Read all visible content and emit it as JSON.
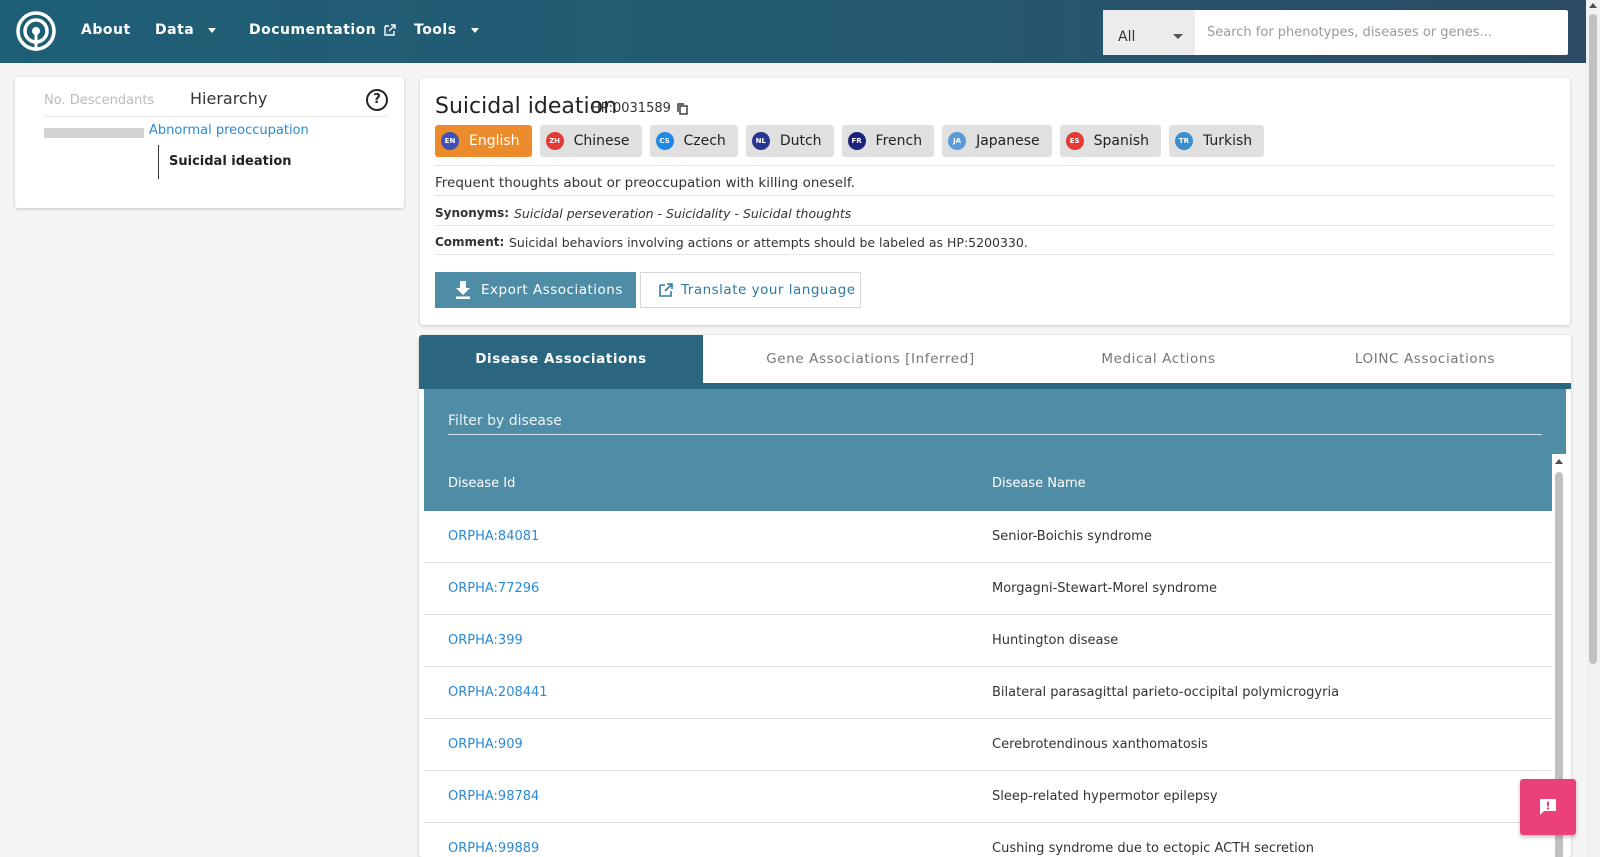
{
  "nav": {
    "about": "About",
    "data": "Data",
    "documentation": "Documentation",
    "tools": "Tools"
  },
  "search": {
    "scope": "All",
    "placeholder": "Search for phenotypes, diseases or genes..."
  },
  "hierarchy": {
    "descendants_label": "No. Descendants",
    "title": "Hierarchy",
    "help": "?",
    "parent": "Abnormal preoccupation",
    "current": "Suicidal ideation"
  },
  "term": {
    "name": "Suicidal ideation",
    "id": "HP:0031589",
    "definition": "Frequent thoughts about or preoccupation with killing oneself.",
    "synonyms_label": "Synonyms:",
    "synonyms": "Suicidal perseveration - Suicidality - Suicidal thoughts",
    "comment_label": "Comment:",
    "comment": "Suicidal behaviors involving actions or attempts should be labeled as HP:5200330.",
    "export_label": "Export Associations",
    "translate_label": "Translate your language"
  },
  "languages": [
    {
      "code": "EN",
      "label": "English",
      "color": "#3f51b5"
    },
    {
      "code": "ZH",
      "label": "Chinese",
      "color": "#e53935"
    },
    {
      "code": "CS",
      "label": "Czech",
      "color": "#1e88e5"
    },
    {
      "code": "NL",
      "label": "Dutch",
      "color": "#283593"
    },
    {
      "code": "FR",
      "label": "French",
      "color": "#1a237e"
    },
    {
      "code": "JA",
      "label": "Japanese",
      "color": "#5c9ad6"
    },
    {
      "code": "ES",
      "label": "Spanish",
      "color": "#e53935"
    },
    {
      "code": "TR",
      "label": "Turkish",
      "color": "#3a8fd0"
    }
  ],
  "tabs": [
    "Disease Associations",
    "Gene Associations [Inferred]",
    "Medical Actions",
    "LOINC Associations"
  ],
  "table": {
    "filter_placeholder": "Filter by disease",
    "col_id": "Disease Id",
    "col_name": "Disease Name",
    "rows": [
      {
        "id": "ORPHA:84081",
        "name": "Senior-Boichis syndrome"
      },
      {
        "id": "ORPHA:77296",
        "name": "Morgagni-Stewart-Morel syndrome"
      },
      {
        "id": "ORPHA:399",
        "name": "Huntington disease"
      },
      {
        "id": "ORPHA:208441",
        "name": "Bilateral parasagittal parieto-occipital polymicrogyria"
      },
      {
        "id": "ORPHA:909",
        "name": "Cerebrotendinous xanthomatosis"
      },
      {
        "id": "ORPHA:98784",
        "name": "Sleep-related hypermotor epilepsy"
      },
      {
        "id": "ORPHA:99889",
        "name": "Cushing syndrome due to ectopic ACTH secretion"
      }
    ]
  },
  "colors": {
    "nav_bg": "#255a72",
    "accent": "#4f8ca6",
    "tab_active": "#2a6680",
    "lang_active": "#ec8b2c",
    "link": "#2b8ad6",
    "feedback": "#ec407a"
  }
}
